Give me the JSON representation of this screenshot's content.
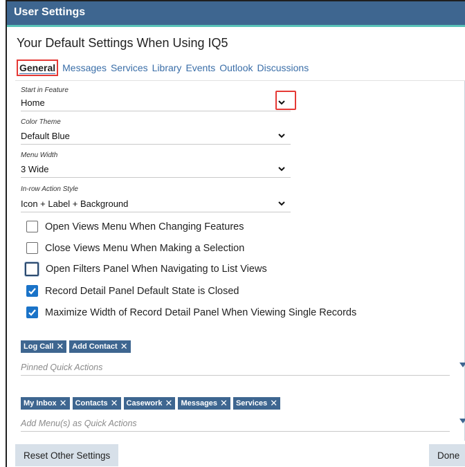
{
  "window": {
    "title": "User Settings"
  },
  "heading": "Your Default Settings When Using IQ5",
  "tabs": [
    {
      "label": "General",
      "active": true
    },
    {
      "label": "Messages"
    },
    {
      "label": "Services"
    },
    {
      "label": "Library"
    },
    {
      "label": "Events"
    },
    {
      "label": "Outlook"
    },
    {
      "label": "Discussions"
    }
  ],
  "fields": {
    "start_feature": {
      "label": "Start in Feature",
      "value": "Home",
      "icon": "chevron-down-icon"
    },
    "color_theme": {
      "label": "Color Theme",
      "value": "Default Blue",
      "icon": "chevron-down-icon"
    },
    "menu_width": {
      "label": "Menu Width",
      "value": "3 Wide",
      "icon": "chevron-down-icon"
    },
    "inrow_action": {
      "label": "In-row Action Style",
      "value": "Icon + Label + Background",
      "icon": "chevron-down-icon"
    }
  },
  "checkboxes": [
    {
      "label": "Open Views Menu When Changing Features",
      "checked": false
    },
    {
      "label": "Close Views Menu When Making a Selection",
      "checked": false
    },
    {
      "label": "Open Filters Panel When Navigating to List Views",
      "checked": false
    },
    {
      "label": "Record Detail Panel Default State is Closed",
      "checked": true
    },
    {
      "label": "Maximize Width of Record Detail Panel When Viewing Single Records",
      "checked": true
    }
  ],
  "pinned": {
    "chips": [
      "Log Call",
      "Add Contact"
    ],
    "placeholder": "Pinned Quick Actions"
  },
  "menus": {
    "chips": [
      "My Inbox",
      "Contacts",
      "Casework",
      "Messages",
      "Services"
    ],
    "placeholder": "Add Menu(s) as Quick Actions"
  },
  "footer": {
    "reset_label": "Reset Other Settings",
    "done_label": "Done"
  },
  "chip_remove_glyph": "✕",
  "colors": {
    "header": "#3e6690",
    "accent": "#59c3b8",
    "link": "#3a6ea8",
    "highlight": "#e53935",
    "check": "#1a73c8"
  }
}
